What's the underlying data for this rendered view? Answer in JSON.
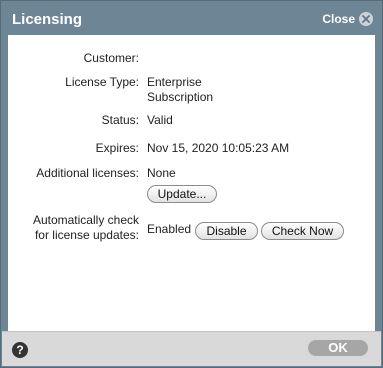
{
  "dialog": {
    "title": "Licensing",
    "close_label": "Close",
    "close_icon": "close-icon"
  },
  "fields": {
    "customer_label": "Customer:",
    "customer_value": "",
    "license_type_label": "License Type:",
    "license_type_value_line1": "Enterprise",
    "license_type_value_line2": "Subscription",
    "status_label": "Status:",
    "status_value": "Valid",
    "expires_label": "Expires:",
    "expires_value": "Nov 15, 2020 10:05:23 AM",
    "additional_label": "Additional licenses:",
    "additional_value": "None",
    "update_button": "Update...",
    "auto_check_label_line1": "Automatically check",
    "auto_check_label_line2": "for license updates:",
    "auto_check_value": "Enabled",
    "disable_button": "Disable",
    "check_now_button": "Check Now"
  },
  "footer": {
    "help_icon": "help-icon",
    "help_glyph": "?",
    "ok_button": "OK"
  },
  "colors": {
    "titlebar": "#6e8596",
    "footer": "#d9d9d9",
    "ok_disabled": "#a6a6a6"
  }
}
